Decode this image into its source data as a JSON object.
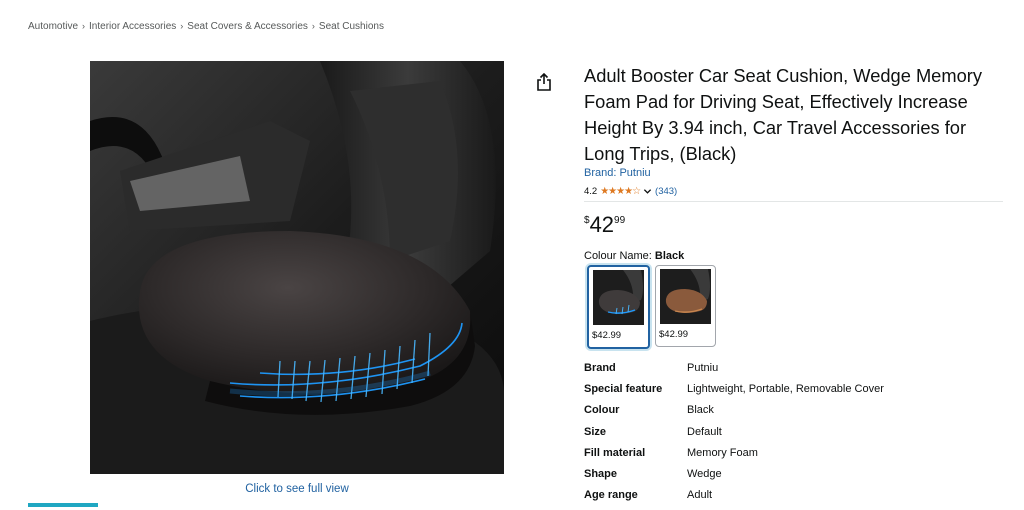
{
  "breadcrumb": {
    "items": [
      "Automotive",
      "Interior Accessories",
      "Seat Covers & Accessories",
      "Seat Cushions"
    ],
    "separator": "›"
  },
  "gallery": {
    "full_view_link": "Click to see full view"
  },
  "product": {
    "title": "Adult Booster Car Seat Cushion, Wedge Memory Foam Pad for Driving Seat, Effectively Increase Height By 3.94 inch, Car Travel Accessories for Long Trips, (Black)",
    "brand_link": "Brand: Putniu",
    "rating": {
      "value": "4.2",
      "stars_value": 4.2,
      "stars_glyphs": "★★★★☆",
      "count": "(343)"
    },
    "price": {
      "symbol": "$",
      "whole": "42",
      "fraction": "99"
    }
  },
  "colour": {
    "label": "Colour Name:",
    "selected": "Black",
    "options": [
      {
        "price": "$42.99",
        "swatch": "black-cushion"
      },
      {
        "price": "$42.99",
        "swatch": "brown-cushion"
      }
    ]
  },
  "specs": [
    {
      "key": "Brand",
      "value": "Putniu"
    },
    {
      "key": "Special feature",
      "value": "Lightweight, Portable, Removable Cover"
    },
    {
      "key": "Colour",
      "value": "Black"
    },
    {
      "key": "Size",
      "value": "Default"
    },
    {
      "key": "Fill material",
      "value": "Memory Foam"
    },
    {
      "key": "Shape",
      "value": "Wedge"
    },
    {
      "key": "Age range",
      "value": "Adult"
    }
  ],
  "icons": {
    "share": "share-icon",
    "rating_dropdown": "chevron-down-icon"
  },
  "colors": {
    "link": "#2162a1",
    "star": "#de7921",
    "accent_glow": "#1e9bff",
    "swatch_selected_border": "#2162a1"
  }
}
